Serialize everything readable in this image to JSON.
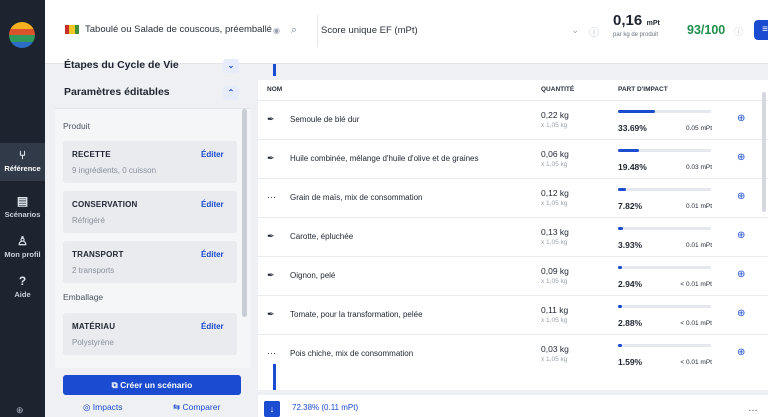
{
  "sidebar": {
    "items": [
      {
        "label": "Référence",
        "icon": "branch-icon"
      },
      {
        "label": "Scénarios",
        "icon": "document-icon"
      },
      {
        "label": "Mon profil",
        "icon": "user-icon"
      },
      {
        "label": "Aide",
        "icon": "help-icon"
      }
    ],
    "bottom_icon": "globe-icon"
  },
  "topbar": {
    "product_name": "Taboulé ou Salade de couscous, préemballé",
    "score_select": "Score unique EF (mPt)",
    "metric_value": "0,16",
    "metric_unit": "mPt",
    "metric_sub": "par kg de produit",
    "grade": "93/100"
  },
  "panel": {
    "title_steps": "Étapes du Cycle de Vie",
    "title_params": "Paramètres éditables",
    "section_product": "Produit",
    "section_packaging": "Emballage",
    "cards": [
      {
        "title": "RECETTE",
        "subtitle": "9 ingrédients, 0 cuisson",
        "edit": "Éditer"
      },
      {
        "title": "CONSERVATION",
        "subtitle": "Réfrigéré",
        "edit": "Éditer"
      },
      {
        "title": "TRANSPORT",
        "subtitle": "2 transports",
        "edit": "Éditer"
      },
      {
        "title": "MATÉRIAU",
        "subtitle": "Polystyrène",
        "edit": "Éditer"
      }
    ],
    "create_scenario": "Créer un scénario",
    "impacts": "Impacts",
    "compare": "Comparer"
  },
  "table": {
    "headers": {
      "name": "NOM",
      "quantity": "QUANTITÉ",
      "impact": "PART D'IMPACT"
    },
    "rows": [
      {
        "icon": "leaf",
        "name": "Semoule de blé dur",
        "qty": "0,22 kg",
        "qty_sub": "x 1,05 kg",
        "pct": "33.69%",
        "share": 0.3369,
        "mpt": "0.05 mPt"
      },
      {
        "icon": "leaf",
        "name": "Huile combinée, mélange d'huile d'olive et de graines",
        "qty": "0,06 kg",
        "qty_sub": "x 1,05 kg",
        "pct": "19.48%",
        "share": 0.1948,
        "mpt": "0.03 mPt"
      },
      {
        "icon": "dots",
        "name": "Grain de maïs, mix de consommation",
        "qty": "0,12 kg",
        "qty_sub": "x 1,05 kg",
        "pct": "7.82%",
        "share": 0.0782,
        "mpt": "0.01 mPt"
      },
      {
        "icon": "leaf",
        "name": "Carotte, épluchée",
        "qty": "0,13 kg",
        "qty_sub": "x 1,05 kg",
        "pct": "3.93%",
        "share": 0.0393,
        "mpt": "0.01 mPt"
      },
      {
        "icon": "leaf",
        "name": "Oignon, pelé",
        "qty": "0,09 kg",
        "qty_sub": "x 1,05 kg",
        "pct": "2.94%",
        "share": 0.0294,
        "mpt": "< 0.01 mPt"
      },
      {
        "icon": "leaf",
        "name": "Tomate, pour la transformation, pelée",
        "qty": "0,11 kg",
        "qty_sub": "x 1,05 kg",
        "pct": "2.88%",
        "share": 0.0288,
        "mpt": "< 0.01 mPt"
      },
      {
        "icon": "dots",
        "name": "Pois chiche, mix de consommation",
        "qty": "0,03 kg",
        "qty_sub": "x 1,05 kg",
        "pct": "1.59%",
        "share": 0.0159,
        "mpt": "< 0.01 mPt"
      }
    ]
  },
  "bottom": {
    "summary": "72.38% (0.11 mPt)"
  },
  "colors": {
    "accent": "#1a4bd1",
    "grade": "#1e8f4a",
    "rail": "#1d2430"
  }
}
